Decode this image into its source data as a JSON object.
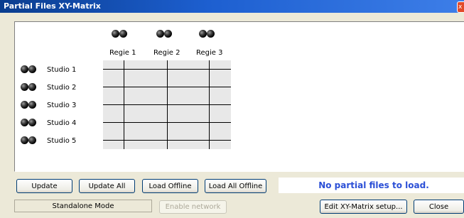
{
  "window": {
    "title": "Partial Files XY-Matrix",
    "close_glyph": "x"
  },
  "matrix": {
    "columns": [
      "Regie 1",
      "Regie 2",
      "Regie 3"
    ],
    "rows": [
      "Studio 1",
      "Studio 2",
      "Studio 3",
      "Studio 4",
      "Studio 5"
    ],
    "icon": "microphone-pair-icon",
    "grid_color": "#e8e8e8"
  },
  "buttons": {
    "update": "Update",
    "update_all": "Update All",
    "load_offline": "Load Offline",
    "load_all_offline": "Load All Offline",
    "enable_network": "Enable network",
    "edit_setup": "Edit XY-Matrix setup...",
    "close": "Close"
  },
  "status": {
    "message": "No partial files to load.",
    "message_color": "#2b4fd6"
  },
  "footer": {
    "mode": "Standalone Mode"
  }
}
